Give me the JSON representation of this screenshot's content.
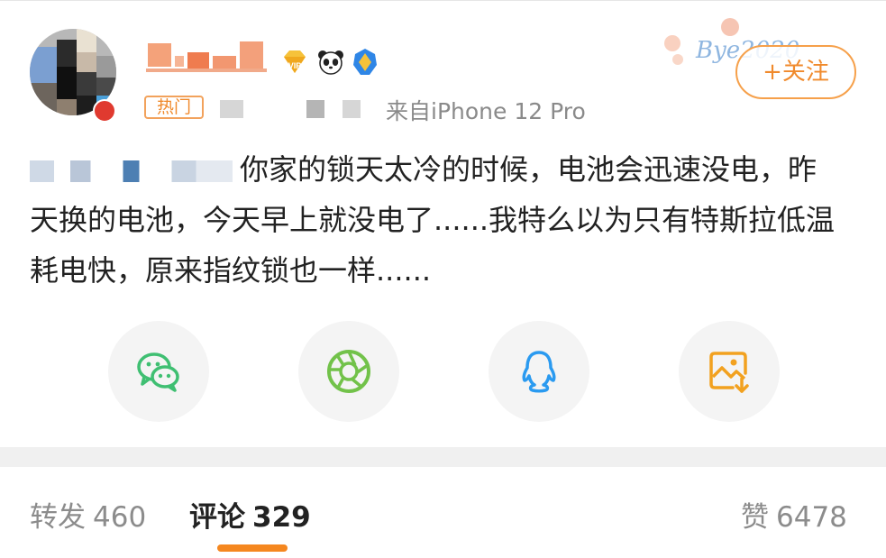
{
  "header": {
    "hot_tag": "热门",
    "source": "来自iPhone 12 Pro",
    "follow_label": "+关注",
    "deco_text": "Bye2020"
  },
  "post": {
    "text": "你家的锁天太冷的时候，电池会迅速没电，昨天换的电池，今天早上就没电了......我特么以为只有特斯拉低温耗电快，原来指纹锁也一样......"
  },
  "share": [
    {
      "icon": "wechat-icon"
    },
    {
      "icon": "moments-icon"
    },
    {
      "icon": "qq-icon"
    },
    {
      "icon": "save-image-icon"
    }
  ],
  "tabs": {
    "repost": {
      "label": "转发",
      "count": "460"
    },
    "comment": {
      "label": "评论",
      "count": "329"
    },
    "like": {
      "label": "赞",
      "count": "6478"
    }
  },
  "colors": {
    "accent": "#f5871f",
    "wechat": "#3fbf72",
    "moments": "#72c24a",
    "qq": "#2a9af0",
    "save": "#f2a11f"
  }
}
